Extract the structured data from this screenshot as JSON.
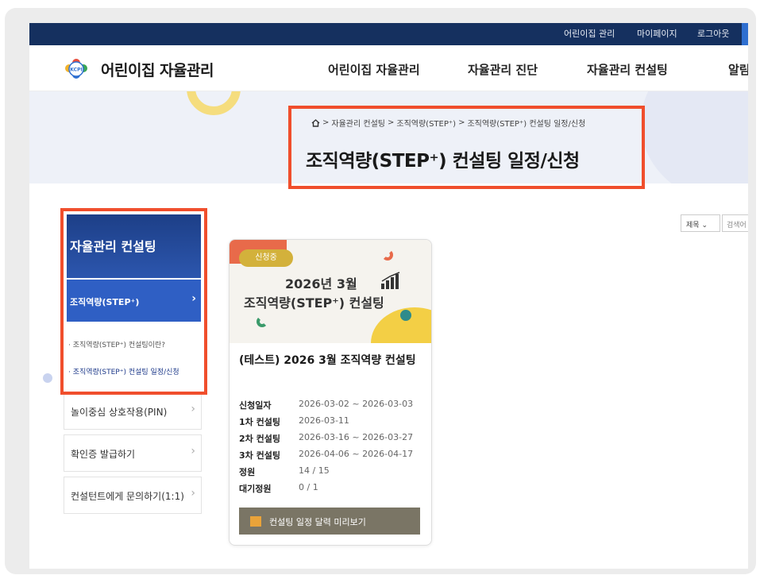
{
  "utility_nav": {
    "items": [
      "어린이집 관리",
      "마이페이지",
      "로그아웃"
    ]
  },
  "header": {
    "logo_text": "어린이집 자율관리",
    "logo_badge": "KCPI",
    "gnb": [
      "어린이집 자율관리",
      "자율관리 진단",
      "자율관리 컨설팅",
      "알림"
    ]
  },
  "hero": {
    "breadcrumb": [
      "자율관리 컨설팅",
      "조직역량(STEP⁺)",
      "조직역량(STEP⁺) 컨설팅 일정/신청"
    ],
    "title": "조직역량(STEP⁺) 컨설팅 일정/신청"
  },
  "sidebar": {
    "heading": "자율관리 컨설팅",
    "active": "조직역량(STEP⁺)",
    "sub_items": [
      "조직역량(STEP⁺) 컨설팅이란?",
      "조직역량(STEP⁺) 컨설팅 일정/신청"
    ],
    "items": [
      "놀이중심 상호작용(PIN)",
      "확인증 발급하기",
      "컨설턴트에게 문의하기(1:1)"
    ]
  },
  "search": {
    "select_value": "제목",
    "placeholder": "검색어"
  },
  "card": {
    "badge": "신청중",
    "thumb_line1": "2026년 3월",
    "thumb_line2": "조직역량(STEP⁺) 컨설팅",
    "title": "(테스트) 2026 3월 조직역량 컨설팅",
    "details": [
      {
        "label": "신청일자",
        "value": "2026-03-02 ~ 2026-03-03"
      },
      {
        "label": "1차 컨설팅",
        "value": "2026-03-11"
      },
      {
        "label": "2차 컨설팅",
        "value": "2026-03-16 ~ 2026-03-27"
      },
      {
        "label": "3차 컨설팅",
        "value": "2026-04-06 ~ 2026-04-17"
      },
      {
        "label": "정원",
        "value": "14 / 15"
      },
      {
        "label": "대기정원",
        "value": "0 / 1"
      }
    ],
    "calendar_button": "컨설팅 일정 달력 미리보기"
  },
  "colors": {
    "topbar": "#15305f",
    "primary": "#2f5fc4",
    "highlight": "#f04e2c",
    "badge": "#d3b13b"
  }
}
